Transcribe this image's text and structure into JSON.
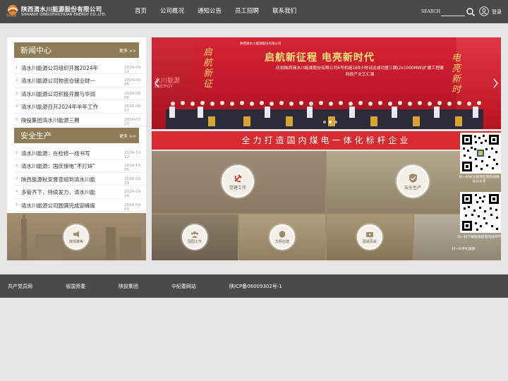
{
  "header": {
    "company_cn": "陕西清水川能源股份有限公司",
    "company_en": "SHAANXI QINGSHUICHUAN ENERGY CO.,LTD.",
    "logo_tag": "陕投集团",
    "nav": [
      "首页",
      "公司概况",
      "通知公告",
      "员工招聘",
      "联系我们"
    ],
    "search_label": "SEARCH",
    "search_placeholder": "",
    "login": "登录"
  },
  "news": {
    "title": "新闻中心",
    "more": "更多 >>",
    "items": [
      {
        "n": "1",
        "text": "清水川能源公司组织开展2024年",
        "date": "2024-09-11"
      },
      {
        "n": "2",
        "text": "清水川能源公司物资仓储业财一",
        "date": "2024-09-05"
      },
      {
        "n": "3",
        "text": "清水川能源公司积极开展与华润",
        "date": "2024-09-05"
      },
      {
        "n": "4",
        "text": "清水川能源召开2024年半年工作",
        "date": "2024-08-07"
      },
      {
        "n": "5",
        "text": "陕投集团清水川能源三期",
        "date": "2024-07-23"
      }
    ]
  },
  "safety": {
    "title": "安全生产",
    "more": "更多 >>",
    "items": [
      {
        "n": "1",
        "text": "清水川能源：在检修一线书写",
        "date": "2024-10-12"
      },
      {
        "n": "2",
        "text": "清水川能源：国庆保电“不打烊”",
        "date": "2024-10-05"
      },
      {
        "n": "3",
        "text": "陕西能源秋安督查组到清水川能",
        "date": "2024-09-29"
      },
      {
        "n": "4",
        "text": "多管齐下，持续发力，清水川能",
        "date": "2024-09-14"
      },
      {
        "n": "5",
        "text": "清水川能源公司圆满完成迎峰度",
        "date": "2024-09-07"
      }
    ]
  },
  "media": {
    "label": "媒体聚焦"
  },
  "banner": {
    "brand": "陕西清水川能源股份有限公司",
    "slogan": "启航新征程 电亮新时代",
    "left_vertical": "启航新征",
    "right_vertical": "电亮新时",
    "subtitle": "庆祝陕西清水川能源股份有限公司6号机组168小时试运成功暨三期(2x1000MW)扩建工程顺利投产文艺汇演",
    "left_text": "水川能源",
    "left_en": "ENERGY"
  },
  "slogan_bar": "全力打造国内煤电一体化标杆企业",
  "tiles": [
    {
      "label": "党建工作"
    },
    {
      "label": "安全生产"
    },
    {
      "label": "团团工作"
    },
    {
      "label": "文明创建"
    },
    {
      "label": "图说风采"
    }
  ],
  "qr": {
    "caption1": "扫一扫关注能源监管热线微信公众号",
    "caption2": "扫一扫下载能源监管热线APP",
    "caption3": "扫一扫手机看新"
  },
  "footer": [
    "共产党员网",
    "省国资委",
    "陕投集团",
    "中纪委网站",
    "陕ICP备06009302号-1"
  ],
  "colors": {
    "header": "#4a4a4a",
    "section": "#8f7c57",
    "slogan_red": "#d62b2f",
    "banner_red": "#c2182a"
  }
}
